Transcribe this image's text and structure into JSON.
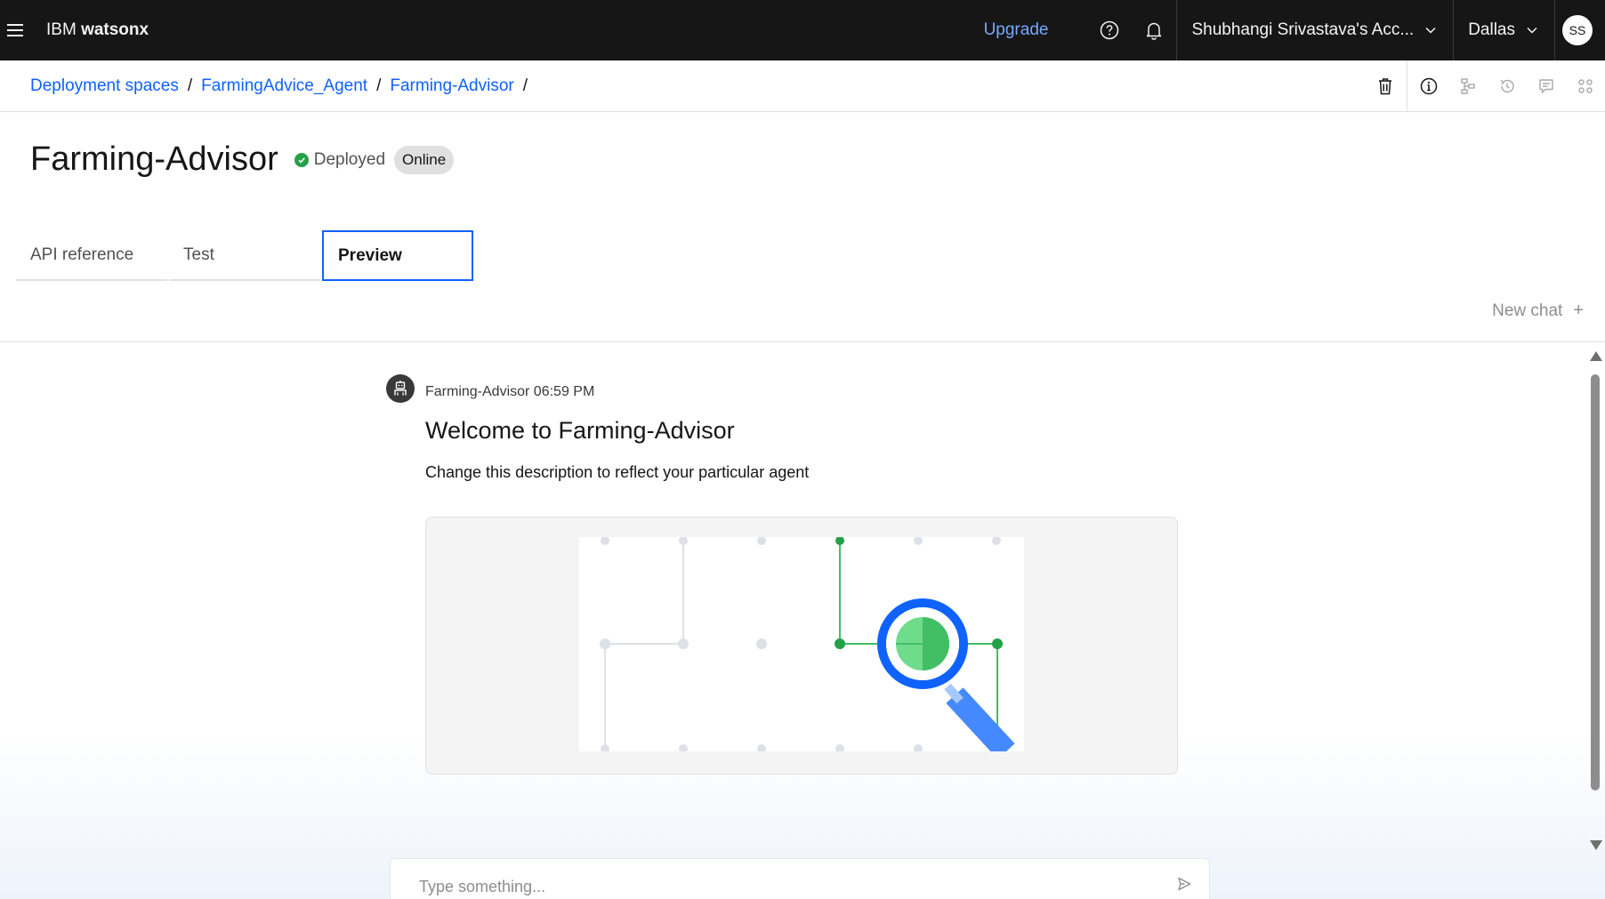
{
  "header": {
    "brand_prefix": "IBM",
    "brand_name": "watsonx",
    "upgrade_label": "Upgrade",
    "account_label": "Shubhangi Srivastava's Acc...",
    "region_label": "Dallas",
    "avatar_initials": "SS"
  },
  "breadcrumb": {
    "items": [
      "Deployment spaces",
      "FarmingAdvice_Agent",
      "Farming-Advisor"
    ],
    "separator": "/"
  },
  "page": {
    "title": "Farming-Advisor",
    "status_label": "Deployed",
    "tag_label": "Online"
  },
  "tabs": [
    {
      "label": "API reference",
      "active": false
    },
    {
      "label": "Test",
      "active": false
    },
    {
      "label": "Preview",
      "active": true
    }
  ],
  "chat": {
    "new_chat_label": "New chat",
    "message": {
      "sender": "Farming-Advisor",
      "time": "06:59 PM",
      "meta": "Farming-Advisor 06:59 PM",
      "title": "Welcome to Farming-Advisor",
      "description": "Change this description to reflect your particular agent"
    },
    "input_placeholder": "Type something..."
  },
  "colors": {
    "topbar": "#161616",
    "link": "#0f62fe",
    "upgrade": "#78a9ff",
    "success": "#24a148",
    "illustration_green": "#42be65",
    "illustration_blue": "#4589ff"
  },
  "icons": [
    "menu-icon",
    "help-icon",
    "notification-icon",
    "chevron-down-icon",
    "trash-icon",
    "info-icon",
    "flow-icon",
    "history-icon",
    "comment-icon",
    "apps-icon",
    "robot-icon",
    "send-icon",
    "add-icon"
  ]
}
